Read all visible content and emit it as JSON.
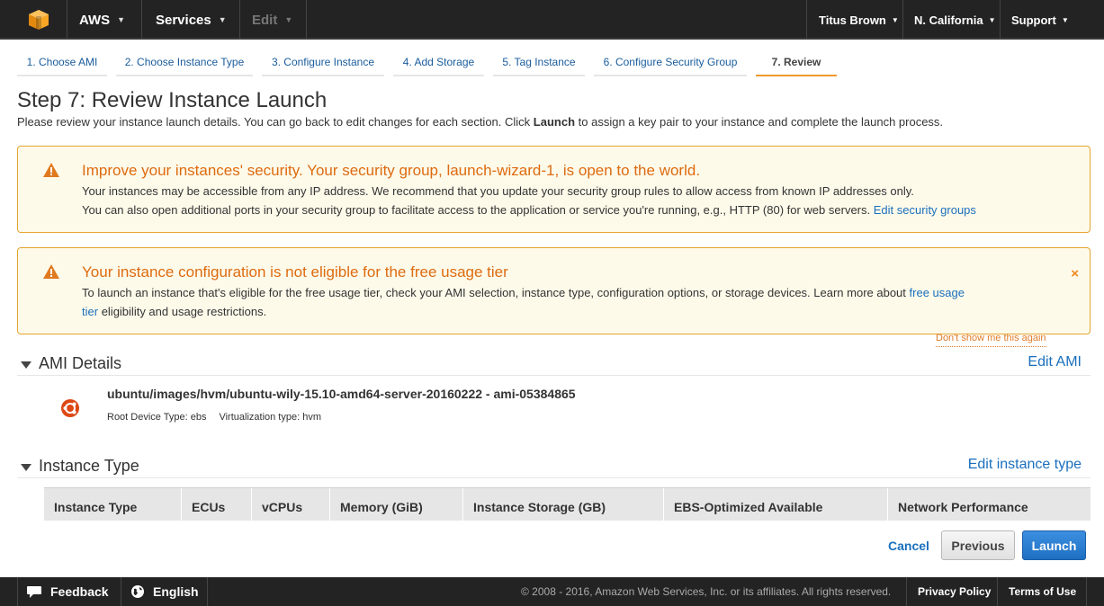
{
  "topnav": {
    "brand": "AWS",
    "services": "Services",
    "edit": "Edit",
    "user": "Titus Brown",
    "region": "N. California",
    "support": "Support"
  },
  "tabs": [
    {
      "label": "1. Choose AMI"
    },
    {
      "label": "2. Choose Instance Type"
    },
    {
      "label": "3. Configure Instance"
    },
    {
      "label": "4. Add Storage"
    },
    {
      "label": "5. Tag Instance"
    },
    {
      "label": "6. Configure Security Group"
    },
    {
      "label": "7. Review",
      "active": true
    }
  ],
  "page": {
    "title": "Step 7: Review Instance Launch",
    "subtitle_pre": "Please review your instance launch details. You can go back to edit changes for each section. Click ",
    "subtitle_bold": "Launch",
    "subtitle_post": " to assign a key pair to your instance and complete the launch process."
  },
  "alert_security": {
    "title": "Improve your instances' security. Your security group, launch-wizard-1, is open to the world.",
    "line1": "Your instances may be accessible from any IP address. We recommend that you update your security group rules to allow access from known IP addresses only.",
    "line2": "You can also open additional ports in your security group to facilitate access to the application or service you're running, e.g., HTTP (80) for web servers.",
    "link": "Edit security groups"
  },
  "alert_freetier": {
    "title": "Your instance configuration is not eligible for the free usage tier",
    "line1": "To launch an instance that's eligible for the free usage tier, check your AMI selection, instance type, configuration options, or storage devices. Learn more about",
    "link_a": "free usage",
    "link_b": "tier",
    "line2_rest": "eligibility and usage restrictions.",
    "close": "×",
    "dont_show": "Don't show me this again"
  },
  "ami": {
    "section_title": "AMI Details",
    "edit_label": "Edit AMI",
    "name": "ubuntu/images/hvm/ubuntu-wily-15.10-amd64-server-20160222 - ami-05384865",
    "root_device": "Root Device Type: ebs",
    "virtualization": "Virtualization type: hvm"
  },
  "instance_type": {
    "section_title": "Instance Type",
    "edit_label": "Edit instance type",
    "columns": [
      "Instance Type",
      "ECUs",
      "vCPUs",
      "Memory (GiB)",
      "Instance Storage (GB)",
      "EBS-Optimized Available",
      "Network Performance"
    ]
  },
  "actions": {
    "cancel": "Cancel",
    "previous": "Previous",
    "launch": "Launch"
  },
  "footer": {
    "feedback": "Feedback",
    "language": "English",
    "copyright": "© 2008 - 2016, Amazon Web Services, Inc. or its affiliates. All rights reserved.",
    "privacy": "Privacy Policy",
    "terms": "Terms of Use"
  },
  "colors": {
    "nav_bg": "#232323",
    "link": "#1a6fbd",
    "warning": "#dd6b10",
    "alert_bg": "#fefaea",
    "active_tab": "#f09b2d",
    "launch_button": "#1e6fc2"
  }
}
